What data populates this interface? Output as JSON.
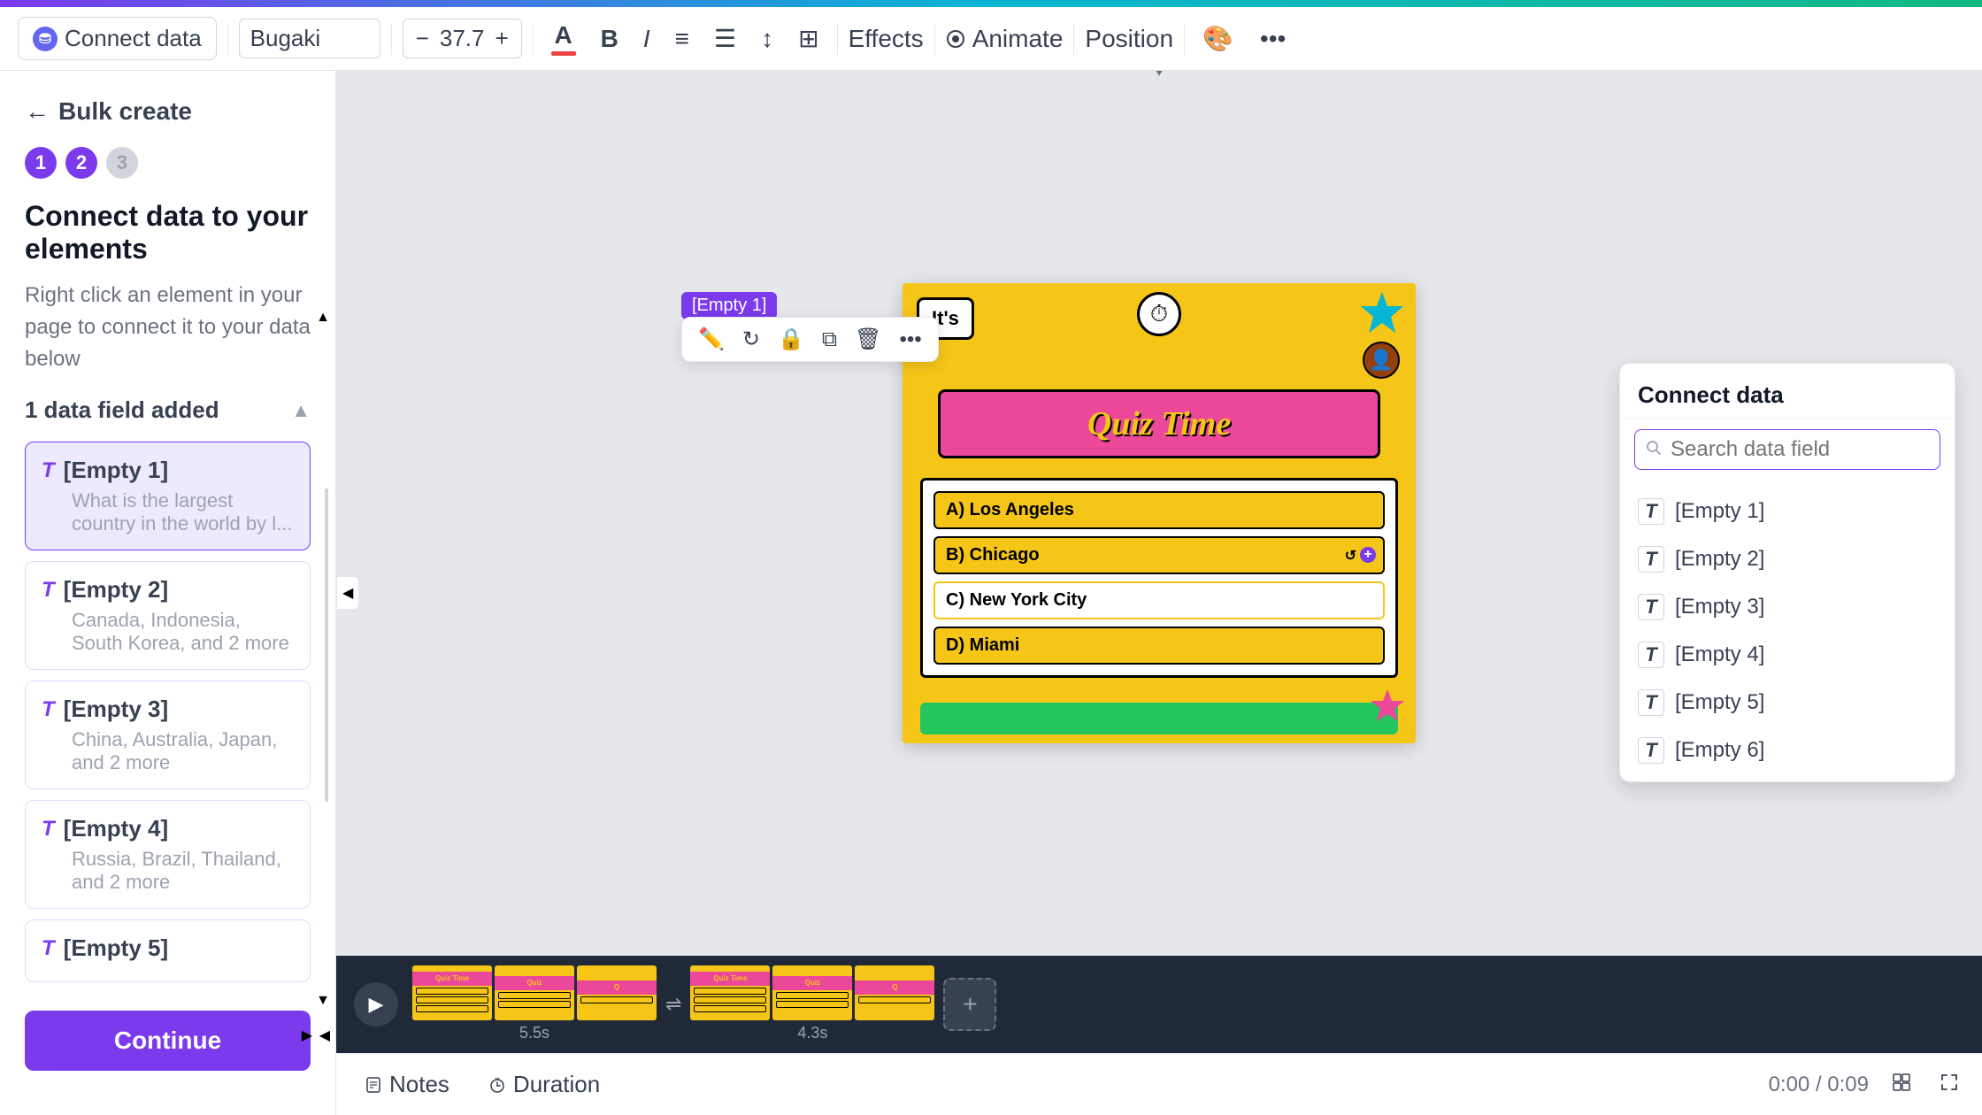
{
  "topbar": {
    "gradient": "linear-gradient(90deg, #7c3aed, #06b6d4, #10b981)"
  },
  "toolbar": {
    "connect_data_label": "Connect data",
    "font_name": "Bugaki",
    "font_size": "37.7",
    "decrease_label": "−",
    "increase_label": "+",
    "effects_label": "Effects",
    "animate_label": "Animate",
    "position_label": "Position"
  },
  "left_panel": {
    "back_label": "Bulk create",
    "steps": [
      {
        "num": "1",
        "active": true
      },
      {
        "num": "2",
        "active": true
      },
      {
        "num": "3",
        "active": false
      }
    ],
    "title": "Connect data to your elements",
    "description": "Right click an element in your page to connect it to your data below",
    "fields_count_label": "1 data field added",
    "fields": [
      {
        "name": "[Empty 1]",
        "values": "What is the largest country in the world by l..."
      },
      {
        "name": "[Empty 2]",
        "values": "Canada, Indonesia, South Korea, and 2 more"
      },
      {
        "name": "[Empty 3]",
        "values": "China, Australia, Japan, and 2 more"
      },
      {
        "name": "[Empty 4]",
        "values": "Russia, Brazil, Thailand, and 2 more"
      },
      {
        "name": "[Empty 5]",
        "values": ""
      }
    ],
    "continue_label": "Continue"
  },
  "canvas": {
    "element_label": "[Empty 1]",
    "quiz_title": "Quiz Time",
    "its_text": "It's",
    "answers": [
      {
        "label": "A) Los Angeles"
      },
      {
        "label": "B) Chicago"
      },
      {
        "label": "C) New York City"
      },
      {
        "label": "D) Miami"
      }
    ]
  },
  "connect_data_dropdown": {
    "title": "Connect data",
    "search_placeholder": "Search data field",
    "items": [
      {
        "name": "[Empty 1]"
      },
      {
        "name": "[Empty 2]"
      },
      {
        "name": "[Empty 3]"
      },
      {
        "name": "[Empty 4]"
      },
      {
        "name": "[Empty 5]"
      },
      {
        "name": "[Empty 6]"
      }
    ]
  },
  "timeline": {
    "slides": [
      {
        "duration": "5.5s"
      },
      {
        "duration": "4.3s"
      }
    ],
    "time": "0:00 / 0:09"
  },
  "bottom_bar": {
    "notes_label": "Notes",
    "duration_label": "Duration",
    "time_display": "0:00 / 0:09"
  }
}
